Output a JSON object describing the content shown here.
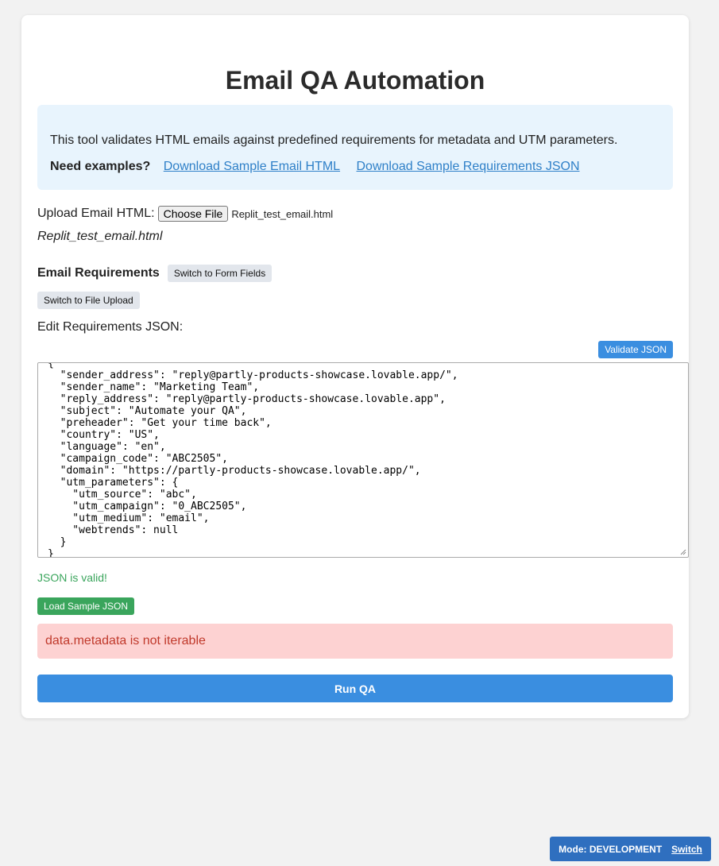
{
  "page": {
    "title": "Email QA Automation"
  },
  "info": {
    "description": "This tool validates HTML emails against predefined requirements for metadata and UTM parameters.",
    "examples_label": "Need examples?",
    "link_email": "Download Sample Email HTML",
    "link_requirements": "Download Sample Requirements JSON"
  },
  "upload": {
    "label": "Upload Email HTML:",
    "choose_button": "Choose File",
    "chosen_file": "Replit_test_email.html",
    "file_display": "Replit_test_email.html"
  },
  "requirements": {
    "label": "Email Requirements",
    "switch_form_button": "Switch to Form Fields",
    "switch_file_button": "Switch to File Upload",
    "edit_label": "Edit Requirements JSON:",
    "validate_button": "Validate JSON",
    "json_text": "{\n  \"sender_address\": \"reply@partly-products-showcase.lovable.app/\",\n  \"sender_name\": \"Marketing Team\",\n  \"reply_address\": \"reply@partly-products-showcase.lovable.app\",\n  \"subject\": \"Automate your QA\",\n  \"preheader\": \"Get your time back\",\n  \"country\": \"US\",\n  \"language\": \"en\",\n  \"campaign_code\": \"ABC2505\",\n  \"domain\": \"https://partly-products-showcase.lovable.app/\",\n  \"utm_parameters\": {\n    \"utm_source\": \"abc\",\n    \"utm_campaign\": \"0_ABC2505\",\n    \"utm_medium\": \"email\",\n    \"webtrends\": null\n  }\n}",
    "valid_message": "JSON is valid!",
    "load_sample_button": "Load Sample JSON"
  },
  "error": {
    "message": "data.metadata is not iterable"
  },
  "actions": {
    "run_button": "Run QA"
  },
  "mode": {
    "label": "Mode: DEVELOPMENT",
    "switch_link": "Switch"
  },
  "colors": {
    "primary": "#3a8ee0",
    "success": "#3aa55c",
    "error_bg": "#fdd2d2",
    "error_text": "#c0392b",
    "info_bg": "#e8f4fd",
    "badge": "#2f6fbf"
  }
}
